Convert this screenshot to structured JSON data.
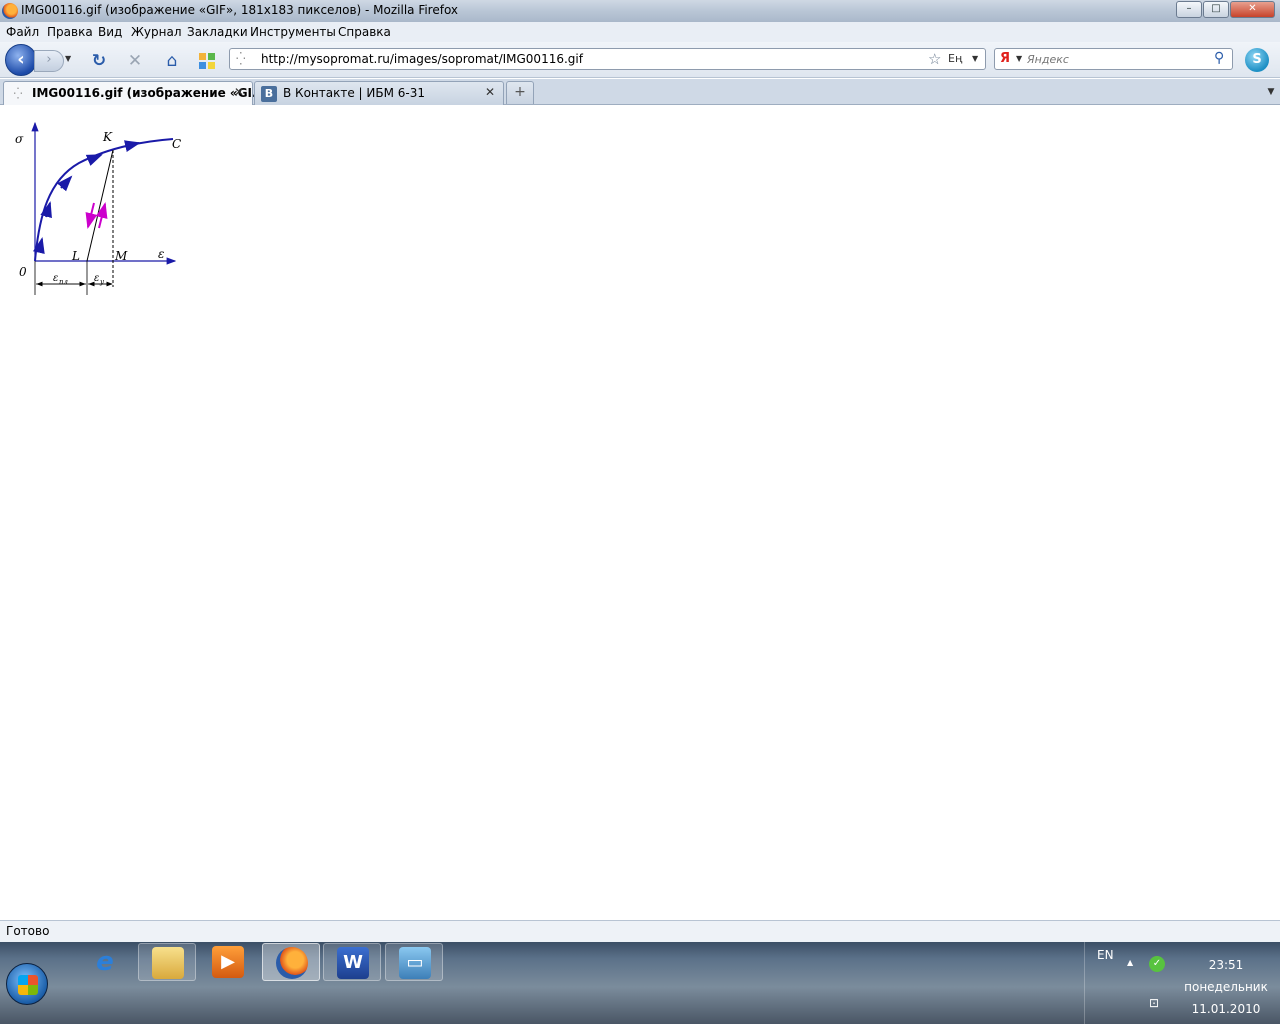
{
  "window": {
    "title": "IMG00116.gif (изображение «GIF», 181x183 пикселов) - Mozilla Firefox",
    "controls": {
      "minimize": "–",
      "maximize": "□",
      "close": "✕"
    }
  },
  "menu": [
    "Файл",
    "Правка",
    "Вид",
    "Журнал",
    "Закладки",
    "Инструменты",
    "Справка"
  ],
  "navigation": {
    "back_icon": "back-arrow-icon",
    "forward_icon": "forward-arrow-icon",
    "reload_icon": "reload-icon",
    "stop_icon": "stop-icon",
    "home_icon": "home-icon",
    "url": "http://mysopromat.ru/images/sopromat/IMG00116.gif",
    "lang_indicator": "Eң",
    "search_engine": "Я",
    "search_placeholder": "Яндекс"
  },
  "tabs": [
    {
      "label": "IMG00116.gif (изображение «GI...",
      "active": true,
      "close": "✕"
    },
    {
      "label": "В Контакте | ИБМ 6-31",
      "active": false,
      "icon_text": "B",
      "close": "✕"
    }
  ],
  "newtab_label": "+",
  "image_labels": {
    "sigma": "σ",
    "epsilon": "ε",
    "origin": "0",
    "K": "K",
    "C": "C",
    "L": "L",
    "M": "M",
    "eps_pl": "ε",
    "eps_pl_sub": "пл",
    "eps_y": "ε",
    "eps_y_sub": "у"
  },
  "colors": {
    "curve": "#1a1aa8",
    "unload_arrow": "#cc00cc",
    "axis": "#1a1aa8"
  },
  "status": "Готово",
  "taskbar": {
    "apps": [
      "internet-explorer-icon",
      "file-explorer-icon",
      "media-player-icon",
      "firefox-icon",
      "word-icon",
      "picture-viewer-icon"
    ],
    "tray": {
      "language": "EN",
      "up_arrow": "▲",
      "time": "23:51",
      "weekday": "понедельник",
      "date": "11.01.2010"
    }
  }
}
